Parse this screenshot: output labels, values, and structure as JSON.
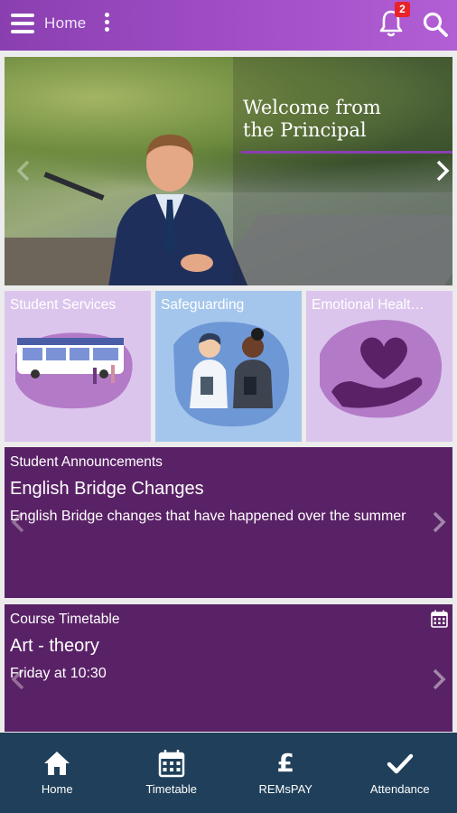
{
  "header": {
    "title": "Home",
    "notification_count": "2",
    "icons": [
      "menu-icon",
      "more-vertical-icon",
      "bell-icon",
      "search-icon"
    ]
  },
  "hero": {
    "title_line1": "Welcome from",
    "title_line2": "the Principal",
    "accent_color": "#8a3fb0"
  },
  "tiles": [
    {
      "label": "Student Services",
      "icon": "bus-station-illustration"
    },
    {
      "label": "Safeguarding",
      "icon": "people-illustration"
    },
    {
      "label": "Emotional Healt…",
      "icon": "heart-hand-illustration"
    }
  ],
  "cards": [
    {
      "category": "Student Announcements",
      "title": "English Bridge Changes",
      "description": "English Bridge changes that have happened over the summer"
    },
    {
      "category": "Course Timetable",
      "title": "Art - theory",
      "description": "Friday at 10:30"
    }
  ],
  "bottom_nav": [
    {
      "label": "Home",
      "icon": "home-icon"
    },
    {
      "label": "Timetable",
      "icon": "calendar-icon"
    },
    {
      "label": "REMsPAY",
      "icon": "pound-icon"
    },
    {
      "label": "Attendance",
      "icon": "checkmark-icon"
    }
  ],
  "colors": {
    "header_gradient_start": "#8a3fb0",
    "card_background": "#5a2266",
    "nav_background": "#1f3f5a",
    "badge": "#e8232a"
  }
}
